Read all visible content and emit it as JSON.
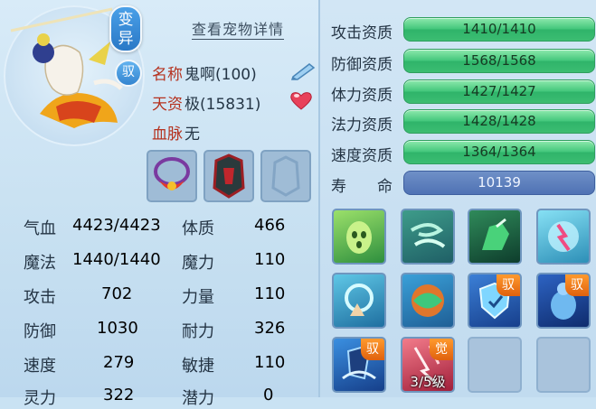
{
  "pet": {
    "mutation_badge": "变异",
    "type_badge": "驭",
    "detail_link": "查看宠物详情",
    "name_label": "名称",
    "name_value": "鬼啊(100)",
    "talent_label": "天资",
    "talent_value": "极(15831)",
    "bloodline_label": "血脉",
    "bloodline_value": "无"
  },
  "attributes": {
    "hp_label": "气血",
    "hp_value": "4423/4423",
    "mp_label": "魔法",
    "mp_value": "1440/1440",
    "atk_label": "攻击",
    "atk_value": "702",
    "def_label": "防御",
    "def_value": "1030",
    "spd_label": "速度",
    "spd_value": "279",
    "spirit_label": "灵力",
    "spirit_value": "322",
    "con_label": "体质",
    "con_value": "466",
    "magic_label": "魔力",
    "magic_value": "110",
    "str_label": "力量",
    "str_value": "110",
    "end_label": "耐力",
    "end_value": "326",
    "agi_label": "敏捷",
    "agi_value": "110",
    "pot_label": "潜力",
    "pot_value": "0"
  },
  "aptitudes": [
    {
      "label": "攻击资质",
      "value": "1410/1410",
      "fill": 1.0
    },
    {
      "label": "防御资质",
      "value": "1568/1568",
      "fill": 1.0
    },
    {
      "label": "体力资质",
      "value": "1427/1427",
      "fill": 1.0
    },
    {
      "label": "法力资质",
      "value": "1428/1428",
      "fill": 1.0
    },
    {
      "label": "速度资质",
      "value": "1364/1364",
      "fill": 1.0
    }
  ],
  "life": {
    "label": "寿　　命",
    "value": "10139"
  },
  "skills": {
    "tag_yu": "驭",
    "tag_jue": "觉",
    "awaken_level": "3/5级"
  },
  "colors": {
    "label_red": "#b5321f",
    "apt_green": "#44c77c",
    "life_blue": "#4f72b4"
  }
}
